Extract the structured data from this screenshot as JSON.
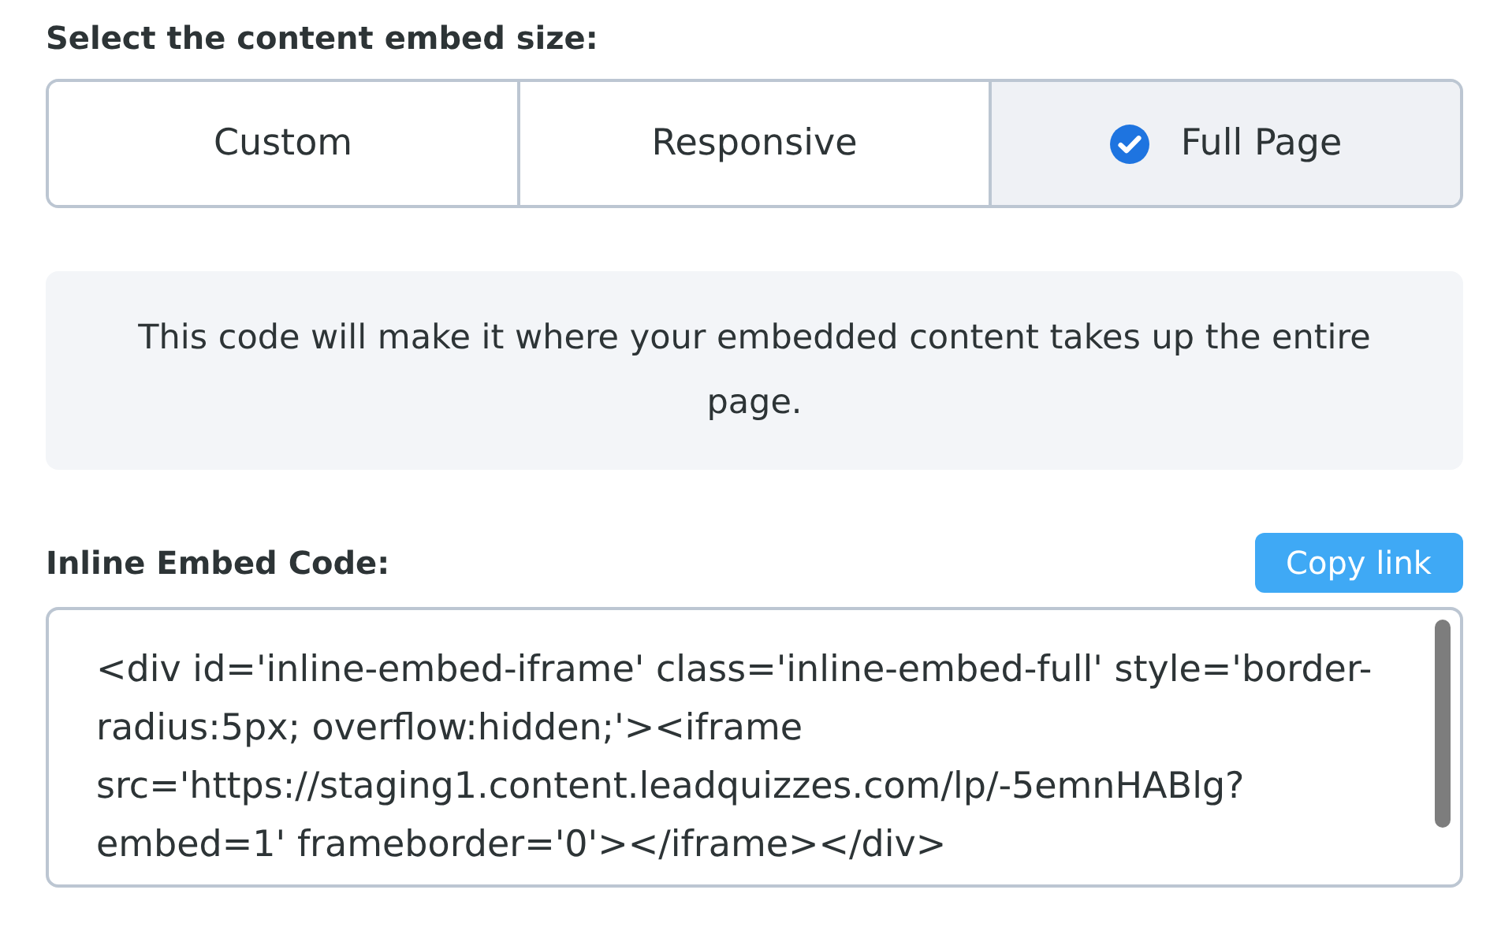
{
  "size_heading": "Select the content embed size:",
  "size_options": [
    {
      "label": "Custom",
      "selected": false
    },
    {
      "label": "Responsive",
      "selected": false
    },
    {
      "label": "Full Page",
      "selected": true
    }
  ],
  "info": "This code will make it where your embedded content takes up the entire page.",
  "embed_label": "Inline Embed Code:",
  "copy_button": "Copy link",
  "embed_code": "<div id='inline-embed-iframe' class='inline-embed-full' style='border-radius:5px; overflow:hidden;'><iframe src='https://staging1.content.leadquizzes.com/lp/-5emnHABlg?embed=1' frameborder='0'></iframe></div>"
}
